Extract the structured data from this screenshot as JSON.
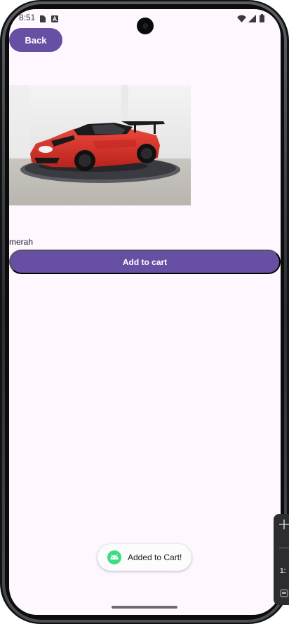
{
  "status_bar": {
    "time": "8:51",
    "icons": [
      "sim-card-icon",
      "a-notification-icon",
      "wifi-icon",
      "signal-icon",
      "battery-icon"
    ]
  },
  "header": {
    "back_label": "Back"
  },
  "product": {
    "image_alt": "red sports car",
    "name": "merah",
    "add_to_cart_label": "Add to cart"
  },
  "toast": {
    "icon": "android-icon",
    "message": "Added to Cart!"
  },
  "emulator_panel": {
    "zoom_icon": "plus-icon",
    "ratio_text": "1:",
    "frame_icon": "frame-icon"
  },
  "colors": {
    "primary": "#6750a4",
    "screen_bg": "#fef7ff",
    "car_red": "#d9312a"
  }
}
